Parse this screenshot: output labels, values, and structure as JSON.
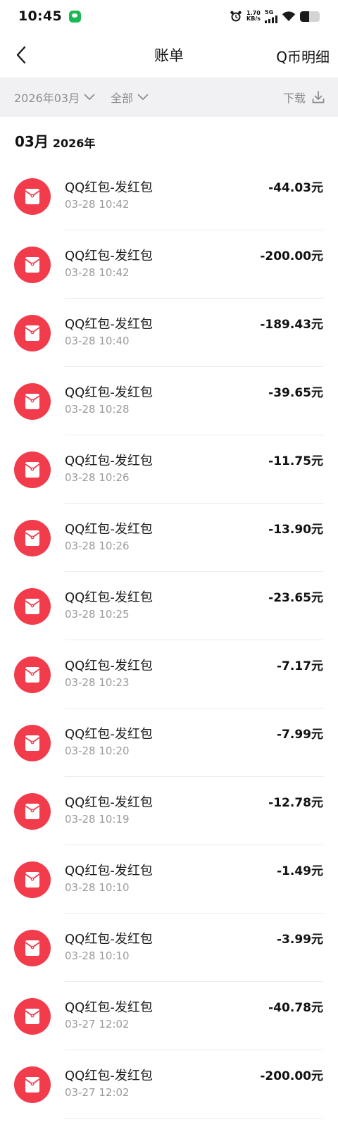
{
  "status_bar": {
    "time": "10:45",
    "net_speed_value": "1.70",
    "net_speed_unit": "KB/s",
    "network": "5G",
    "battery_level": 0.45,
    "icons": [
      "wechat-icon",
      "alarm-clock-icon",
      "signal-icon",
      "wifi-icon",
      "battery-icon"
    ]
  },
  "nav": {
    "title": "账单",
    "right_label": "Q币明细",
    "back_icon": "chevron-left-icon"
  },
  "filters": {
    "month": "2026年03月",
    "category": "全部",
    "download": "下载"
  },
  "section": {
    "month": "03月",
    "year": "2026年"
  },
  "colors": {
    "accent_red": "#f23c4c",
    "filter_bg": "#f1f1f3",
    "muted_text": "#9b9b9b"
  },
  "transactions": [
    {
      "title": "QQ红包-发红包",
      "time": "03-28 10:42",
      "amount": "-44.03元"
    },
    {
      "title": "QQ红包-发红包",
      "time": "03-28 10:42",
      "amount": "-200.00元"
    },
    {
      "title": "QQ红包-发红包",
      "time": "03-28 10:40",
      "amount": "-189.43元"
    },
    {
      "title": "QQ红包-发红包",
      "time": "03-28 10:28",
      "amount": "-39.65元"
    },
    {
      "title": "QQ红包-发红包",
      "time": "03-28 10:26",
      "amount": "-11.75元"
    },
    {
      "title": "QQ红包-发红包",
      "time": "03-28 10:26",
      "amount": "-13.90元"
    },
    {
      "title": "QQ红包-发红包",
      "time": "03-28 10:25",
      "amount": "-23.65元"
    },
    {
      "title": "QQ红包-发红包",
      "time": "03-28 10:23",
      "amount": "-7.17元"
    },
    {
      "title": "QQ红包-发红包",
      "time": "03-28 10:20",
      "amount": "-7.99元"
    },
    {
      "title": "QQ红包-发红包",
      "time": "03-28 10:19",
      "amount": "-12.78元"
    },
    {
      "title": "QQ红包-发红包",
      "time": "03-28 10:10",
      "amount": "-1.49元"
    },
    {
      "title": "QQ红包-发红包",
      "time": "03-28 10:10",
      "amount": "-3.99元"
    },
    {
      "title": "QQ红包-发红包",
      "time": "03-27 12:02",
      "amount": "-40.78元"
    },
    {
      "title": "QQ红包-发红包",
      "time": "03-27 12:02",
      "amount": "-200.00元"
    }
  ]
}
